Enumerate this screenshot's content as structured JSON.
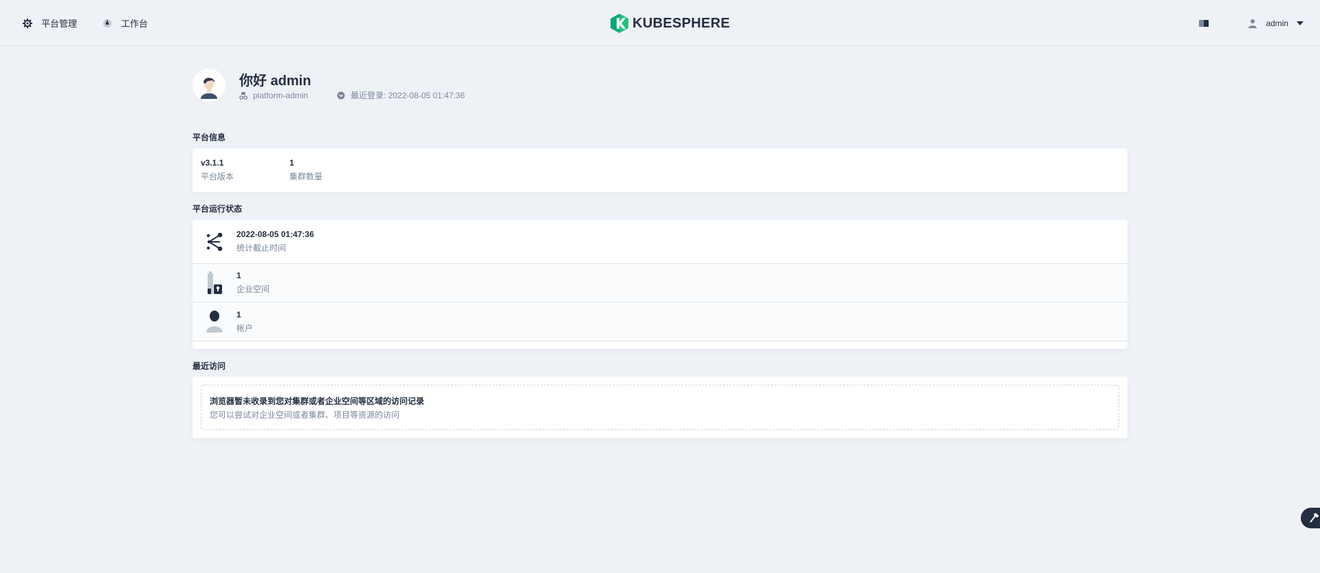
{
  "header": {
    "nav": [
      {
        "label": "平台管理",
        "icon": "gear-icon"
      },
      {
        "label": "工作台",
        "icon": "workbench-icon"
      }
    ],
    "logo_text": "KUBESPHERE",
    "user": {
      "name": "admin"
    }
  },
  "profile": {
    "greeting": "你好 admin",
    "role": "platform-admin",
    "last_login": "最近登录: 2022-08-05 01:47:36"
  },
  "platform_info": {
    "title": "平台信息",
    "items": [
      {
        "value": "v3.1.1",
        "label": "平台版本"
      },
      {
        "value": "1",
        "label": "集群数量"
      }
    ]
  },
  "platform_status": {
    "title": "平台运行状态",
    "items": [
      {
        "value": "2022-08-05 01:47:36",
        "label": "统计截止时间",
        "icon": "share-icon"
      },
      {
        "value": "1",
        "label": "企业空间",
        "icon": "enterprise-space-icon"
      },
      {
        "value": "1",
        "label": "帐户",
        "icon": "account-icon"
      }
    ]
  },
  "recent": {
    "title": "最近访问",
    "empty_title": "浏览器暂未收录到您对集群或者企业空间等区域的访问记录",
    "empty_desc": "您可以尝试对企业空间或者集群、项目等资源的访问"
  },
  "colors": {
    "background": "#eef2f6",
    "text": "#242e42",
    "muted": "#79879c",
    "brand_green": "#00aa72"
  }
}
